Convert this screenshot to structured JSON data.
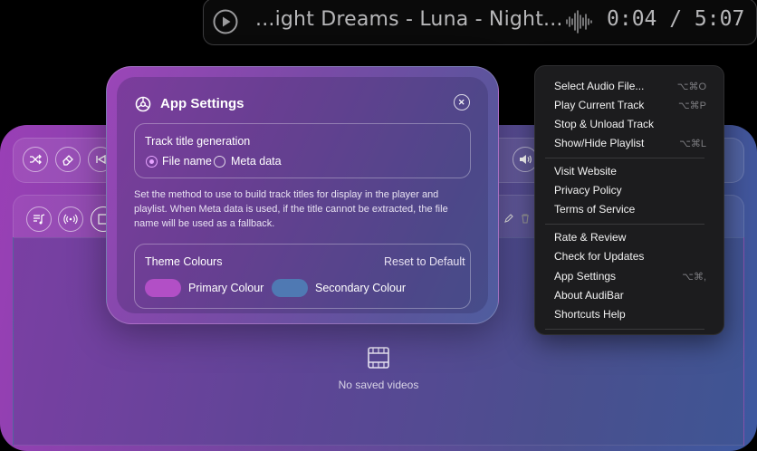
{
  "now_playing": {
    "title": "...ight Dreams - Luna - Night...",
    "time": "0:04 / 5:07",
    "icons": [
      "play-icon",
      "waveform-icon"
    ]
  },
  "dialog": {
    "title": "App Settings",
    "track_title": {
      "heading": "Track title generation",
      "options": [
        "File name",
        "Meta data"
      ],
      "selected": "File name"
    },
    "description": "Set the method to use to build track titles for display in the player and playlist. When Meta data is used, if the title cannot be extracted, the file name will be used as a fallback.",
    "theme": {
      "heading": "Theme Colours",
      "reset": "Reset to Default",
      "primary_label": "Primary Colour",
      "secondary_label": "Secondary Colour",
      "primary_color": "#b24fc6",
      "secondary_color": "#4f79b3"
    }
  },
  "player": {
    "empty_text": "No saved videos"
  },
  "menu": {
    "groups": [
      [
        {
          "label": "Select Audio File...",
          "shortcut": "⌥⌘O"
        },
        {
          "label": "Play Current Track",
          "shortcut": "⌥⌘P"
        },
        {
          "label": "Stop & Unload Track",
          "shortcut": ""
        },
        {
          "label": "Show/Hide Playlist",
          "shortcut": "⌥⌘L"
        }
      ],
      [
        {
          "label": "Visit Website",
          "shortcut": ""
        },
        {
          "label": "Privacy Policy",
          "shortcut": ""
        },
        {
          "label": "Terms of Service",
          "shortcut": ""
        }
      ],
      [
        {
          "label": "Rate & Review",
          "shortcut": ""
        },
        {
          "label": "Check for Updates",
          "shortcut": ""
        },
        {
          "label": "App Settings",
          "shortcut": "⌥⌘,"
        },
        {
          "label": "About AudiBar",
          "shortcut": ""
        },
        {
          "label": "Shortcuts Help",
          "shortcut": ""
        }
      ]
    ]
  }
}
